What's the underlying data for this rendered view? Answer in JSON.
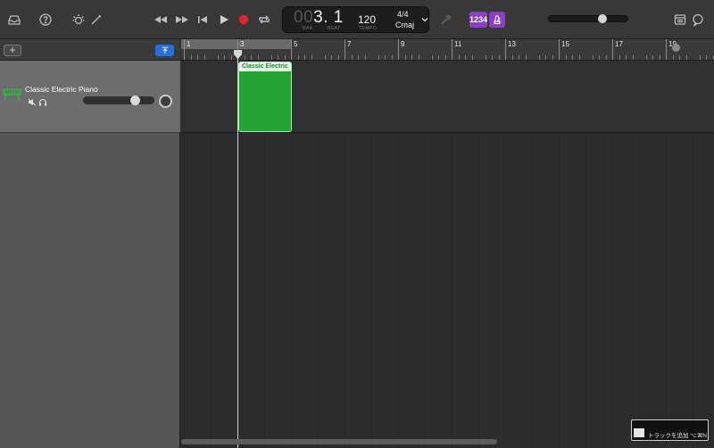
{
  "toolbar": {
    "lcd": {
      "bar_dim": "00",
      "bar_value": "3. 1",
      "bar_label": "BAR",
      "beat_label": "BEAT",
      "tempo": "120",
      "tempo_label": "TEMPO",
      "time_signature": "4/4",
      "key": "Cmaj"
    },
    "count_in_badge": "1234",
    "master_volume_level": 0.68,
    "colors": {
      "record": "#e0232c",
      "badge": "#8b3fc4",
      "smart_controls": "#2a6ed6"
    }
  },
  "track_list": {
    "add_label": "+",
    "tracks": [
      {
        "name": "Classic Electric Piano",
        "volume_level": 0.7
      }
    ]
  },
  "ruler": {
    "labels": [
      "1",
      "3",
      "5",
      "7",
      "9",
      "11",
      "13",
      "15",
      "17",
      "19"
    ]
  },
  "region": {
    "title": "Classic Electric",
    "color": "#22a535"
  },
  "tooltip": {
    "text": "トラックを追加 ⌥⌘N"
  }
}
